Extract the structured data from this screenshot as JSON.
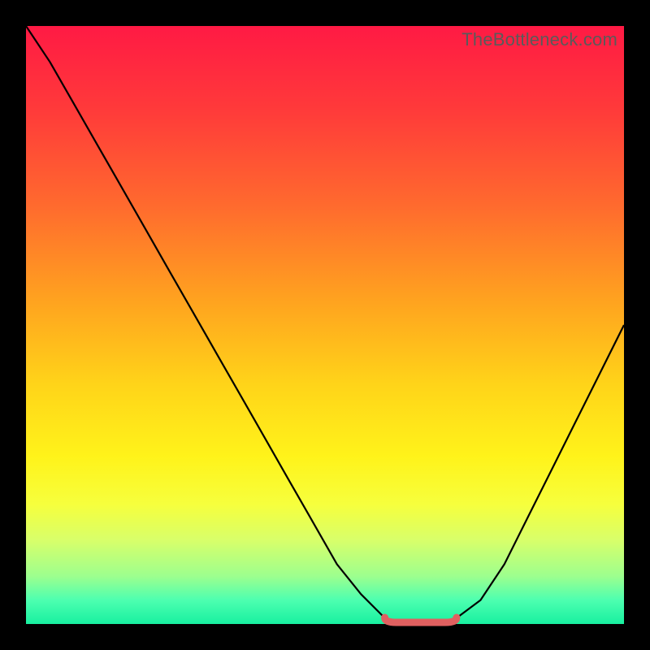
{
  "watermark": "TheBottleneck.com",
  "colors": {
    "frame": "#000000",
    "gradient_top": "#ff1a44",
    "gradient_mid": "#fff31a",
    "gradient_bottom": "#18f0a0",
    "curve": "#000000",
    "marker": "#e06060"
  },
  "chart_data": {
    "type": "line",
    "title": "",
    "xlabel": "",
    "ylabel": "",
    "xlim": [
      0,
      100
    ],
    "ylim": [
      0,
      100
    ],
    "x": [
      0,
      4,
      8,
      12,
      16,
      20,
      24,
      28,
      32,
      36,
      40,
      44,
      48,
      52,
      56,
      60,
      64,
      68,
      72,
      76,
      80,
      84,
      88,
      92,
      96,
      100
    ],
    "values": [
      100,
      94,
      87,
      80,
      73,
      66,
      59,
      52,
      45,
      38,
      31,
      24,
      17,
      10,
      5,
      1,
      0,
      0,
      1,
      4,
      10,
      18,
      26,
      34,
      42,
      50
    ],
    "annotations": [
      {
        "kind": "highlight_segment",
        "x_start": 60,
        "x_end": 72,
        "y": 0
      }
    ]
  }
}
